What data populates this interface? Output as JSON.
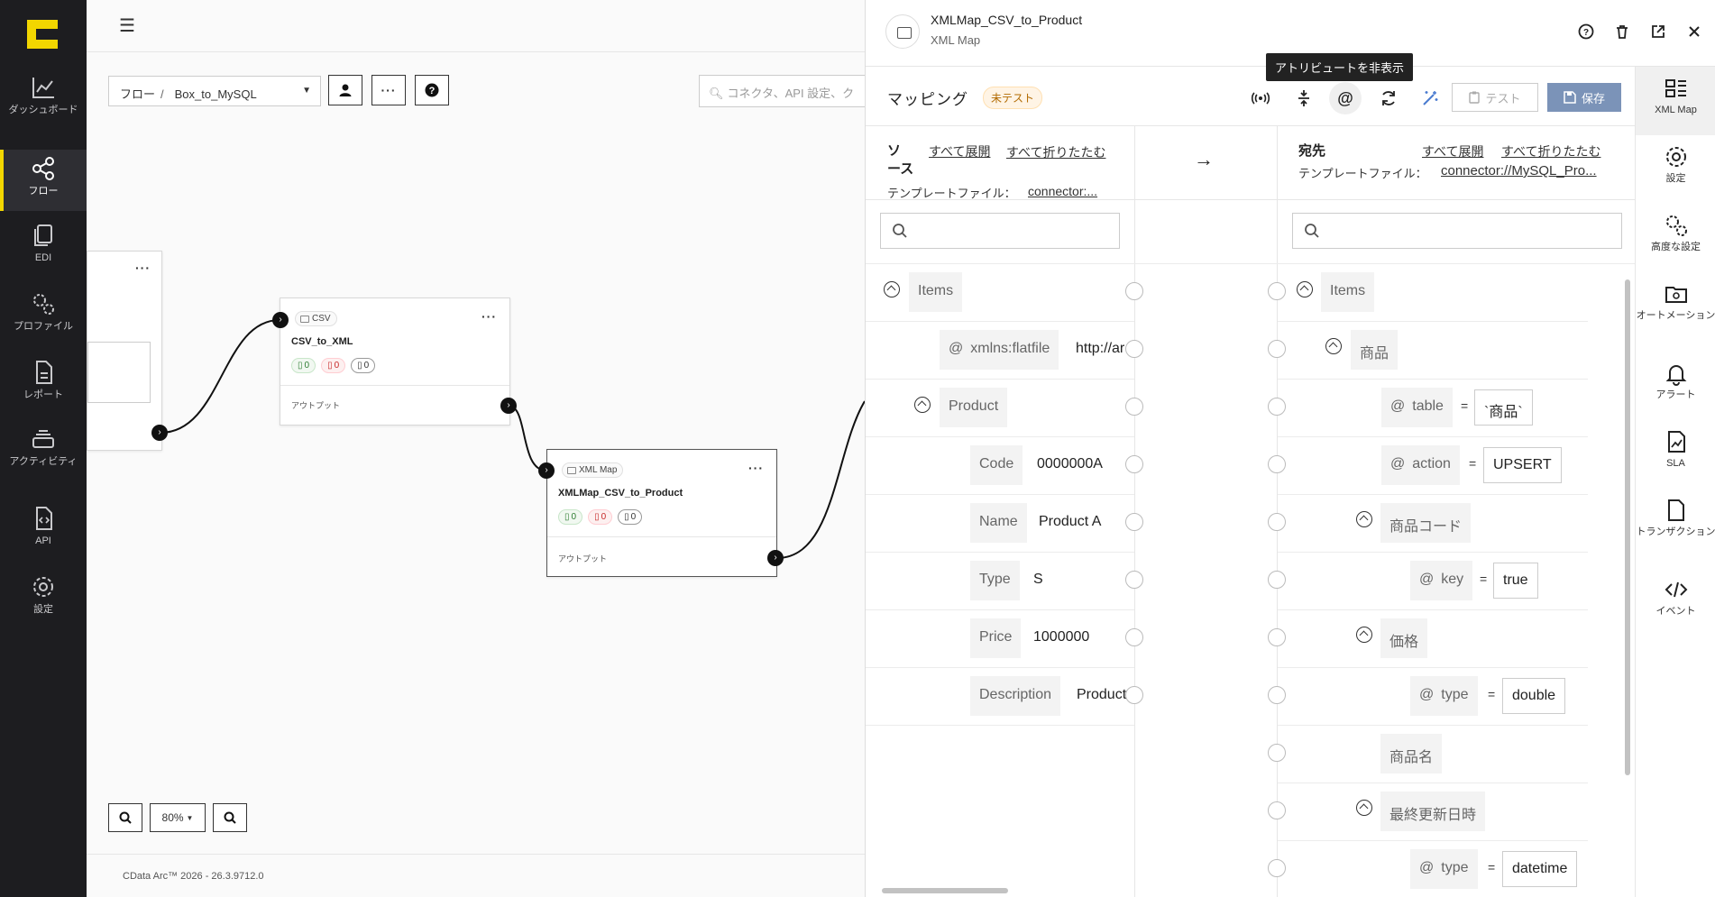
{
  "nav": {
    "items": [
      {
        "label": "ダッシュボード",
        "icon": "chart-line-icon"
      },
      {
        "label": "フロー",
        "icon": "share-nodes-icon"
      },
      {
        "label": "EDI",
        "icon": "documents-icon"
      },
      {
        "label": "プロファイル",
        "icon": "gears-icon"
      },
      {
        "label": "レポート",
        "icon": "report-icon"
      },
      {
        "label": "アクティビティ",
        "icon": "layers-icon"
      },
      {
        "label": "API",
        "icon": "api-file-icon"
      },
      {
        "label": "設定",
        "icon": "gear-icon"
      }
    ]
  },
  "canvas": {
    "breadcrumb_root": "フロー",
    "breadcrumb_sep": "/",
    "flow_name": "Box_to_MySQL",
    "search_placeholder": "コネクタ、API 設定、ク",
    "zoom_level": "80%",
    "footer": "CData Arc™ 2026 - 26.3.9712.0",
    "nodes": [
      {
        "type": "CSV",
        "name": "CSV_to_XML",
        "success": "0",
        "error": "0",
        "pending": "0",
        "output": "アウトプット"
      },
      {
        "type": "XML Map",
        "name": "XMLMap_CSV_to_Product",
        "success": "0",
        "error": "0",
        "pending": "0",
        "output": "アウトプット"
      }
    ]
  },
  "panel": {
    "title": "XMLMap_CSV_to_Product",
    "subtitle": "XML Map",
    "tooltip": "アトリビュートを非表示",
    "mapping_label": "マッピング",
    "untested_badge": "未テスト",
    "test_label": "テスト",
    "save_label": "保存",
    "source": {
      "heading": "ソース",
      "expand_all": "すべて展開",
      "collapse_all": "すべて折りたたむ",
      "template_label": "テンプレートファイル：",
      "template_value": "connector:...",
      "rows": [
        {
          "label": "Items"
        },
        {
          "label": "xmlns:flatfile",
          "value": "http://ar"
        },
        {
          "label": "Product"
        },
        {
          "label": "Code",
          "value": "0000000A"
        },
        {
          "label": "Name",
          "value": "Product A"
        },
        {
          "label": "Type",
          "value": "S"
        },
        {
          "label": "Price",
          "value": "1000000"
        },
        {
          "label": "Description",
          "value": "Product"
        }
      ]
    },
    "arrow": "→",
    "dest": {
      "heading": "宛先",
      "expand_all": "すべて展開",
      "collapse_all": "すべて折りたたむ",
      "template_label": "テンプレートファイル：",
      "template_value": "connector://MySQL_Pro...",
      "rows": [
        {
          "label": "Items"
        },
        {
          "label": "商品"
        },
        {
          "label": "table",
          "value": "`商品`"
        },
        {
          "label": "action",
          "value": "UPSERT"
        },
        {
          "label": "商品コード"
        },
        {
          "label": "key",
          "value": "true"
        },
        {
          "label": "価格"
        },
        {
          "label": "type",
          "value": "double"
        },
        {
          "label": "商品名"
        },
        {
          "label": "最終更新日時"
        },
        {
          "label": "type",
          "value": "datetime"
        }
      ]
    },
    "eq": "="
  },
  "rtabs": [
    {
      "label": "XML Map",
      "icon": "xml-map-icon"
    },
    {
      "label": "設定",
      "icon": "gear-icon"
    },
    {
      "label": "高度な設定",
      "icon": "advanced-gears-icon"
    },
    {
      "label": "オートメーション",
      "icon": "automation-folder-icon"
    },
    {
      "label": "アラート",
      "icon": "bell-icon"
    },
    {
      "label": "SLA",
      "icon": "sla-icon"
    },
    {
      "label": "トランザクション",
      "icon": "transaction-file-icon"
    },
    {
      "label": "イベント",
      "icon": "code-icon"
    }
  ]
}
